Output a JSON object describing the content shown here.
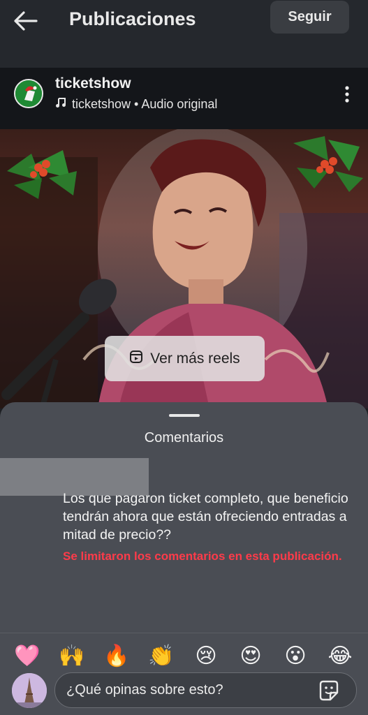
{
  "header": {
    "title": "Publicaciones",
    "follow_label": "Seguir",
    "icons": [
      "back-arrow-icon"
    ]
  },
  "post": {
    "username": "ticketshow",
    "audio_text": "ticketshow • Audio original",
    "icons": [
      "music-note-icon",
      "more-options-icon"
    ],
    "reels_button_label": "Ver más reels"
  },
  "comments": {
    "title": "Comentarios",
    "comment_text": "Los que pagaron ticket completo, que beneficio tendrán ahora que están ofreciendo entradas a mitad de precio??",
    "restricted_notice": "Se limitaron los comentarios en esta publicación."
  },
  "reactions": {
    "emojis": [
      "🩷",
      "🙌",
      "🔥",
      "👏",
      "😢",
      "😍",
      "😮",
      "😂"
    ]
  },
  "input": {
    "placeholder": "¿Qué opinas sobre esto?"
  },
  "colors": {
    "background": "#1d1f23",
    "sheet": "#4a4d54",
    "restricted_text": "#ff3b4a",
    "follow_button": "#3a3d42"
  }
}
